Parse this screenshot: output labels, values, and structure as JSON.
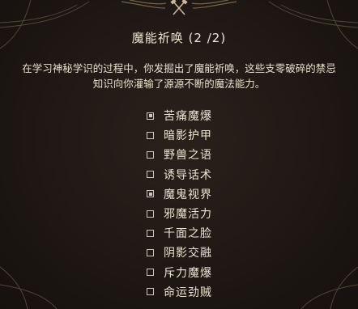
{
  "window": {
    "title": "魔能祈唤 (2 /2)",
    "description": "在学习神秘学识的过程中，你发掘出了魔能祈唤，这些支零破碎的禁忌知识向你灌输了源源不断的魔法能力。"
  },
  "invocations": [
    {
      "label": "苦痛魔爆",
      "checked": true
    },
    {
      "label": "暗影护甲",
      "checked": false
    },
    {
      "label": "野兽之语",
      "checked": false
    },
    {
      "label": "诱导话术",
      "checked": false
    },
    {
      "label": "魔鬼视界",
      "checked": true
    },
    {
      "label": "邪魔活力",
      "checked": false
    },
    {
      "label": "千面之脸",
      "checked": false
    },
    {
      "label": "阴影交融",
      "checked": false
    },
    {
      "label": "斥力魔爆",
      "checked": false
    },
    {
      "label": "命运劲贼",
      "checked": false
    }
  ],
  "icons": {
    "crest": "crossed-hammers-icon"
  }
}
